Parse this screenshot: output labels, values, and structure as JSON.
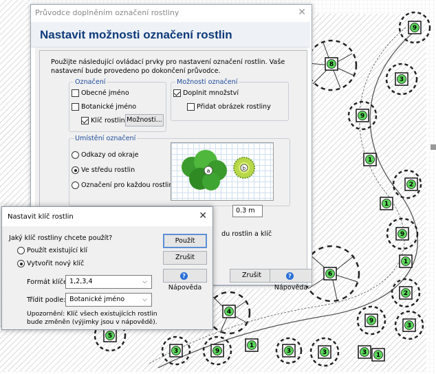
{
  "plant_tags": [
    {
      "number": "9"
    },
    {
      "number": "8"
    },
    {
      "number": "3"
    },
    {
      "number": "9"
    },
    {
      "number": "1"
    },
    {
      "number": "2"
    },
    {
      "number": "1"
    },
    {
      "number": "9"
    },
    {
      "number": "1"
    },
    {
      "number": "2"
    },
    {
      "number": "9"
    },
    {
      "number": "3"
    },
    {
      "number": "6"
    },
    {
      "number": "4"
    },
    {
      "number": "5"
    },
    {
      "number": "3"
    },
    {
      "number": "9"
    },
    {
      "number": "1"
    },
    {
      "number": "3"
    },
    {
      "number": "3"
    },
    {
      "number": "3"
    },
    {
      "number": "1"
    }
  ],
  "wizard": {
    "title": "Průvodce doplněním označení rostliny",
    "heading": "Nastavit možnosti označení rostlin",
    "intro": "Použijte následující ovládací prvky pro nastavení označení rostlin. Vaše nastavení bude provedeno po dokončení průvodce.",
    "labeling": {
      "legend": "Označení",
      "common_name": "Obecné jméno",
      "botanical_name": "Botanické jméno",
      "plant_key": "Klíč rostliny",
      "options_button": "Možnosti..."
    },
    "label_options": {
      "legend": "Možnosti označení",
      "add_quantity": "Doplnit množství",
      "add_image": "Přidat obrázek rostliny"
    },
    "placement": {
      "legend": "Umístění označení",
      "offset_from_edge": "Odkazy od okraje",
      "center": "Ve středu rostlin",
      "each_plant": "Označení pro každou rostlinu",
      "preview_letter_a": "a",
      "preview_letter_b": "b"
    },
    "partial_label": "M",
    "size_value": "0.3 m",
    "partial_text": "du rostlin a klíč",
    "cancel": "Zrušit",
    "help": "Nápověda"
  },
  "key_dialog": {
    "title": "Nastavit klíč rostlin",
    "question": "Jaký klíč rostliny chcete použít?",
    "use_existing": "Použít existující klí",
    "create_new": "Vytvořit nový klíč",
    "format_label": "Formát klíče:",
    "format_value": "1,2,3,4",
    "sort_label": "Třídit podle:",
    "sort_value": "Botanické jméno",
    "note": "Upozornění: Klíč všech existujících rostlin bude změněn (výjimky jsou v nápovědě).",
    "apply": "Použít",
    "cancel": "Zrušit",
    "help": "Nápověda"
  },
  "colors": {
    "tag_green": "#5cd65c",
    "heading_blue": "#0d3a7a",
    "legend_blue": "#1b4a9a"
  }
}
